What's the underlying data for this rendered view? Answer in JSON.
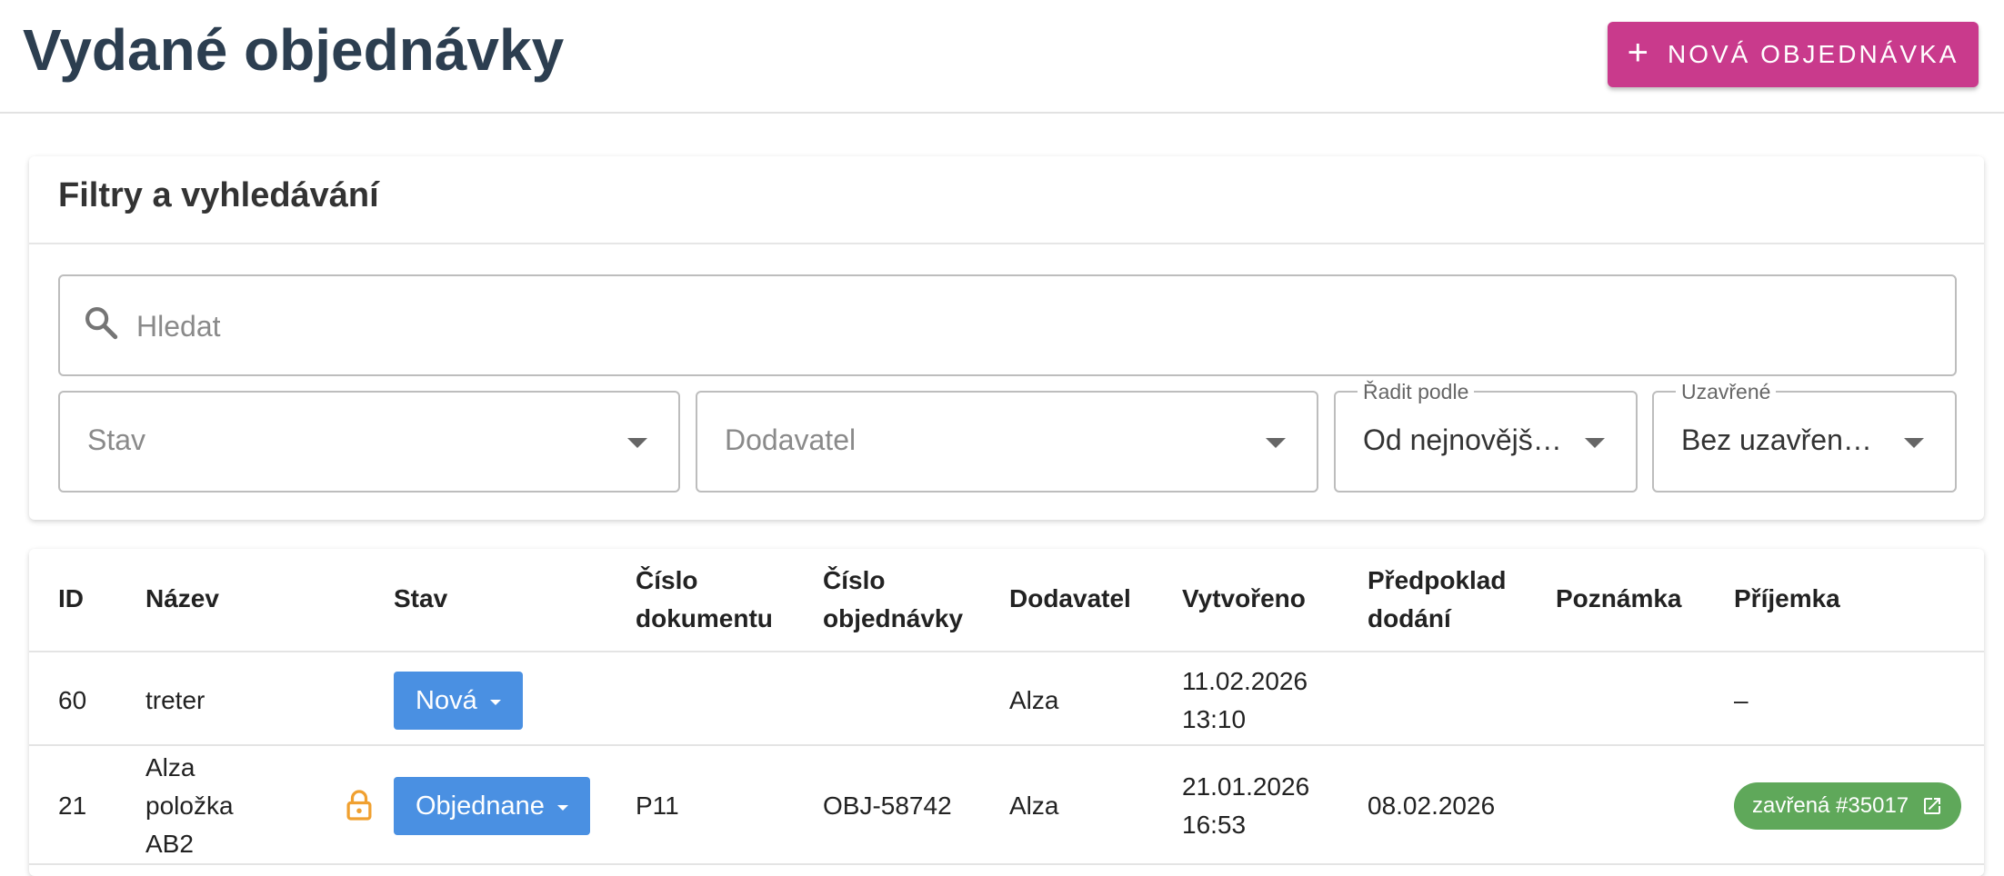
{
  "header": {
    "title": "Vydané objednávky",
    "new_button_label": "NOVÁ OBJEDNÁVKA",
    "new_button_icon": "plus-icon",
    "accent_color": "#c93a8c"
  },
  "filters": {
    "title": "Filtry a vyhledávání",
    "search": {
      "placeholder": "Hledat",
      "value": "",
      "icon": "search-icon"
    },
    "status": {
      "placeholder": "Stav",
      "value": ""
    },
    "supplier": {
      "placeholder": "Dodavatel",
      "value": ""
    },
    "sort": {
      "label": "Řadit podle",
      "value": "Od nejnovějš…"
    },
    "closed": {
      "label": "Uzavřené",
      "value": "Bez uzavřen…"
    }
  },
  "table": {
    "columns": {
      "id": "ID",
      "name": "Název",
      "status": "Stav",
      "doc_number_1": "Číslo",
      "doc_number_2": "dokumentu",
      "order_number_1": "Číslo",
      "order_number_2": "objednávky",
      "supplier": "Dodavatel",
      "created": "Vytvořeno",
      "expected_1": "Předpoklad",
      "expected_2": "dodání",
      "note": "Poznámka",
      "receipt": "Příjemka"
    },
    "rows": [
      {
        "id": "60",
        "name": [
          "treter"
        ],
        "locked": false,
        "status": "Nová",
        "doc_number": "",
        "order_number": "",
        "supplier": "Alza",
        "created_date": "11.02.2026",
        "created_time": "13:10",
        "expected": "",
        "note": "",
        "receipt": "–"
      },
      {
        "id": "21",
        "name": [
          "Alza",
          "položka",
          "AB2"
        ],
        "locked": true,
        "status": "Objednane",
        "doc_number": "P11",
        "order_number": "OBJ-58742",
        "supplier": "Alza",
        "created_date": "21.01.2026",
        "created_time": "16:53",
        "expected": "08.02.2026",
        "note": "",
        "receipt": "zavřená #35017",
        "receipt_icon": "external-link-icon"
      }
    ],
    "status_color": "#4a90e2",
    "receipt_color": "#5fa85a",
    "lock_color": "#f0a030"
  }
}
